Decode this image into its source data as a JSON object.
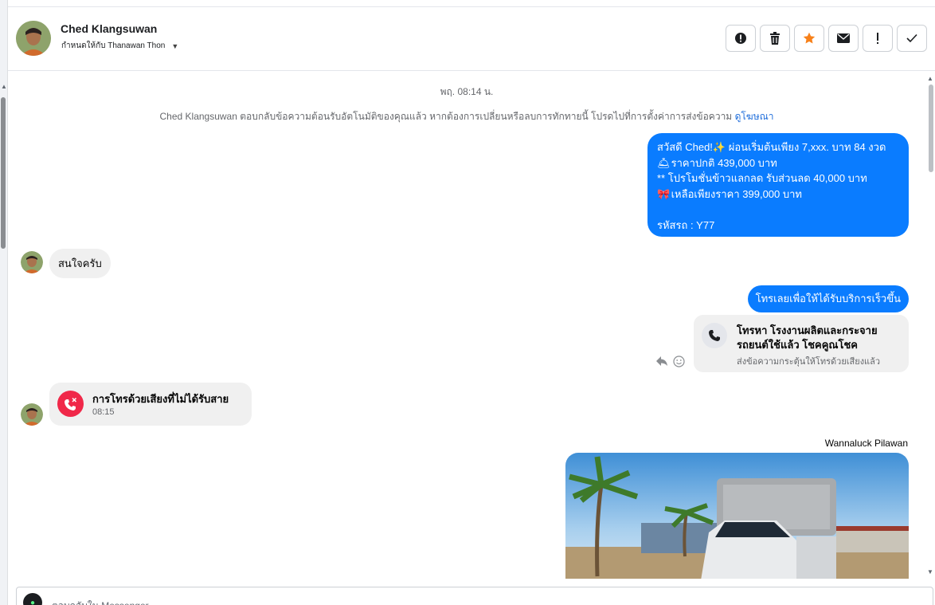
{
  "header": {
    "name": "Ched Klangsuwan",
    "assign_label": "กำหนดให้กับ Thanawan Thon",
    "actions": [
      {
        "icon": "exclamation-circle-icon",
        "glyph": "!"
      },
      {
        "icon": "trash-icon",
        "glyph": "🗑"
      },
      {
        "icon": "star-icon",
        "glyph": "★"
      },
      {
        "icon": "envelope-icon",
        "glyph": "✉"
      },
      {
        "icon": "exclamation-icon",
        "glyph": "!"
      },
      {
        "icon": "check-icon",
        "glyph": "✓"
      }
    ]
  },
  "chat": {
    "timestamp": "พฤ. 08:14 น.",
    "notice_text": "Ched Klangsuwan ตอบกลับข้อความต้อนรับอัตโนมัติของคุณแล้ว หากต้องการเปลี่ยนหรือลบการทักทายนี้ โปรดไปที่การตั้งค่าการส่งข้อความ",
    "notice_link": "ดูโฆษณา",
    "msg1": {
      "line1": "สวัสดี Ched!✨  ผ่อนเริ่มต้นเพียง 7,xxx. บาท 84 งวด",
      "line2_emoji": "🛎",
      "line2": " ราคาปกติ 439,000 บาท",
      "line3": "** โปรโมชั่นข้าวแลกลด รับส่วนลด 40,000 บาท",
      "line4_emoji": "🎀",
      "line4": "  เหลือเพียงราคา 399,000 บาท",
      "line5": "",
      "line6": " รหัสรถ : Y77"
    },
    "msg2": "สนใจครับ",
    "msg3": "โทรเลยเพื่อให้ได้รับบริการเร็วขึ้น",
    "call_card": {
      "title": "โทรหา โรงงานผลิตและกระจายรถยนต์ใช้แล้ว โชคคูณโชค",
      "subtitle": "ส่งข้อความกระตุ้นให้โทรด้วยเสียงแล้ว"
    },
    "missed_call": {
      "title": "การโทรด้วยเสียงที่ไม่ได้รับสาย",
      "time": "08:15"
    },
    "sender_name": "Wannaluck Pilawan"
  },
  "composer": {
    "placeholder": "ตอบกลับใน Messenger"
  }
}
